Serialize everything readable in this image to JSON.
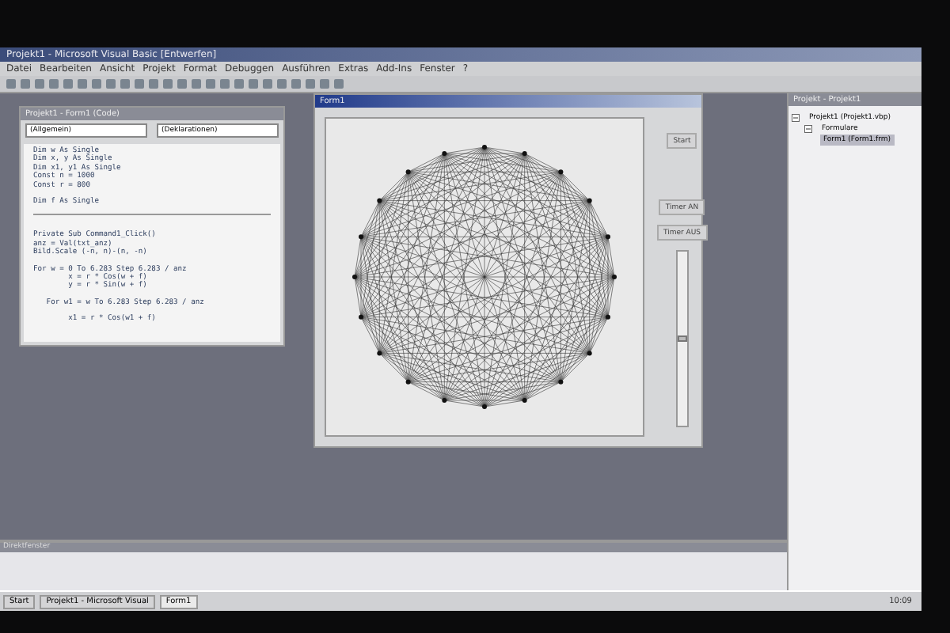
{
  "ide": {
    "title": "Projekt1 - Microsoft Visual Basic [Entwerfen]",
    "menu": [
      "Datei",
      "Bearbeiten",
      "Ansicht",
      "Projekt",
      "Format",
      "Debuggen",
      "Ausführen",
      "Extras",
      "Add-Ins",
      "Fenster",
      "?"
    ]
  },
  "code_window": {
    "title": "Projekt1 - Form1 (Code)",
    "object_dropdown": "(Allgemein)",
    "procedure_dropdown": "(Deklarationen)",
    "declarations": [
      [
        "Dim w As Single",
        "Dim x, y As Single",
        "Dim x1, y1 As Single",
        "Const n = 1000",
        "Const r = 800"
      ],
      [
        "Dim f As Single"
      ]
    ],
    "procedure": [
      [
        "Private Sub Command1_Click()",
        "anz = Val(txt_anz)",
        "Bild.Scale (-n, n)-(n, -n)"
      ],
      [
        "For w = 0 To 6.283 Step 6.283 / anz",
        "        x = r * Cos(w + f)",
        "        y = r * Sin(w + f)"
      ],
      [
        "   For w1 = w To 6.283 Step 6.283 / anz"
      ],
      [
        "        x1 = r * Cos(w1 + f)"
      ]
    ]
  },
  "form_window": {
    "title": "Form1",
    "buttons": [
      "Start",
      "Timer AN",
      "Timer AUS"
    ],
    "scroll": {
      "level": 0.5
    }
  },
  "project_explorer": {
    "title": "Projekt - Projekt1",
    "tree": [
      {
        "label": "Projekt1 (Projekt1.vbp)",
        "expanded": true,
        "selected": false,
        "children": [
          {
            "label": "Formulare",
            "expanded": true,
            "selected": false,
            "children": [
              {
                "label": "Form1 (Form1.frm)",
                "selected": true
              }
            ]
          }
        ]
      }
    ]
  },
  "immediate_window": {
    "title": "Direktfenster"
  },
  "taskbar": {
    "start": "Start",
    "tasks": [
      {
        "label": "Projekt1 - Microsoft Visual",
        "selected": false
      },
      {
        "label": "Form1",
        "selected": true
      }
    ],
    "clock": "10:09"
  }
}
